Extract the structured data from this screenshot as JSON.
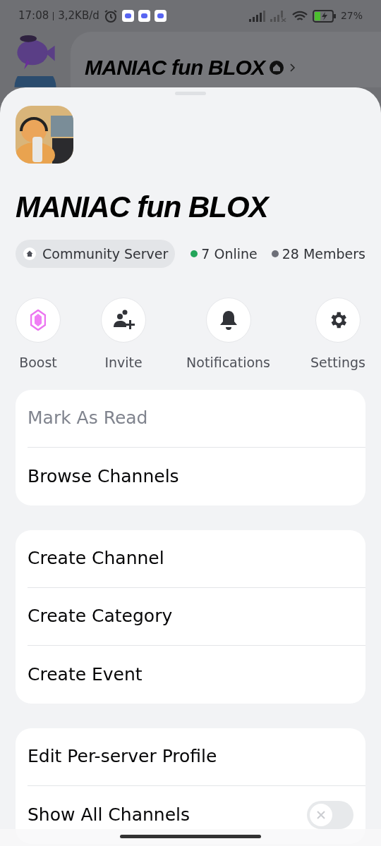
{
  "status_bar": {
    "time": "17:08",
    "speed": "3,2KB/d",
    "battery": "27%"
  },
  "background": {
    "server_title": "MANIAC fun BLOX"
  },
  "server": {
    "name": "MANIAC fun BLOX",
    "community_label": "Community Server",
    "online": {
      "text": "7 Online",
      "color": "#23a55a"
    },
    "members": {
      "text": "28 Members",
      "color": "#6d6f78"
    }
  },
  "actions": [
    {
      "label": "Boost",
      "kind": "boost"
    },
    {
      "label": "Invite",
      "kind": "invite"
    },
    {
      "label": "Notifications",
      "kind": "bell"
    },
    {
      "label": "Settings",
      "kind": "gear"
    }
  ],
  "menu_groups": [
    [
      {
        "label": "Mark As Read",
        "kind": "action",
        "disabled": true
      },
      {
        "label": "Browse Channels",
        "kind": "action",
        "disabled": false
      }
    ],
    [
      {
        "label": "Create Channel",
        "kind": "action",
        "disabled": false
      },
      {
        "label": "Create Category",
        "kind": "action",
        "disabled": false
      },
      {
        "label": "Create Event",
        "kind": "action",
        "disabled": false
      }
    ],
    [
      {
        "label": "Edit Per-server Profile",
        "kind": "action",
        "disabled": false
      },
      {
        "label": "Show All Channels",
        "kind": "toggle",
        "on": false,
        "disabled": false
      }
    ]
  ]
}
